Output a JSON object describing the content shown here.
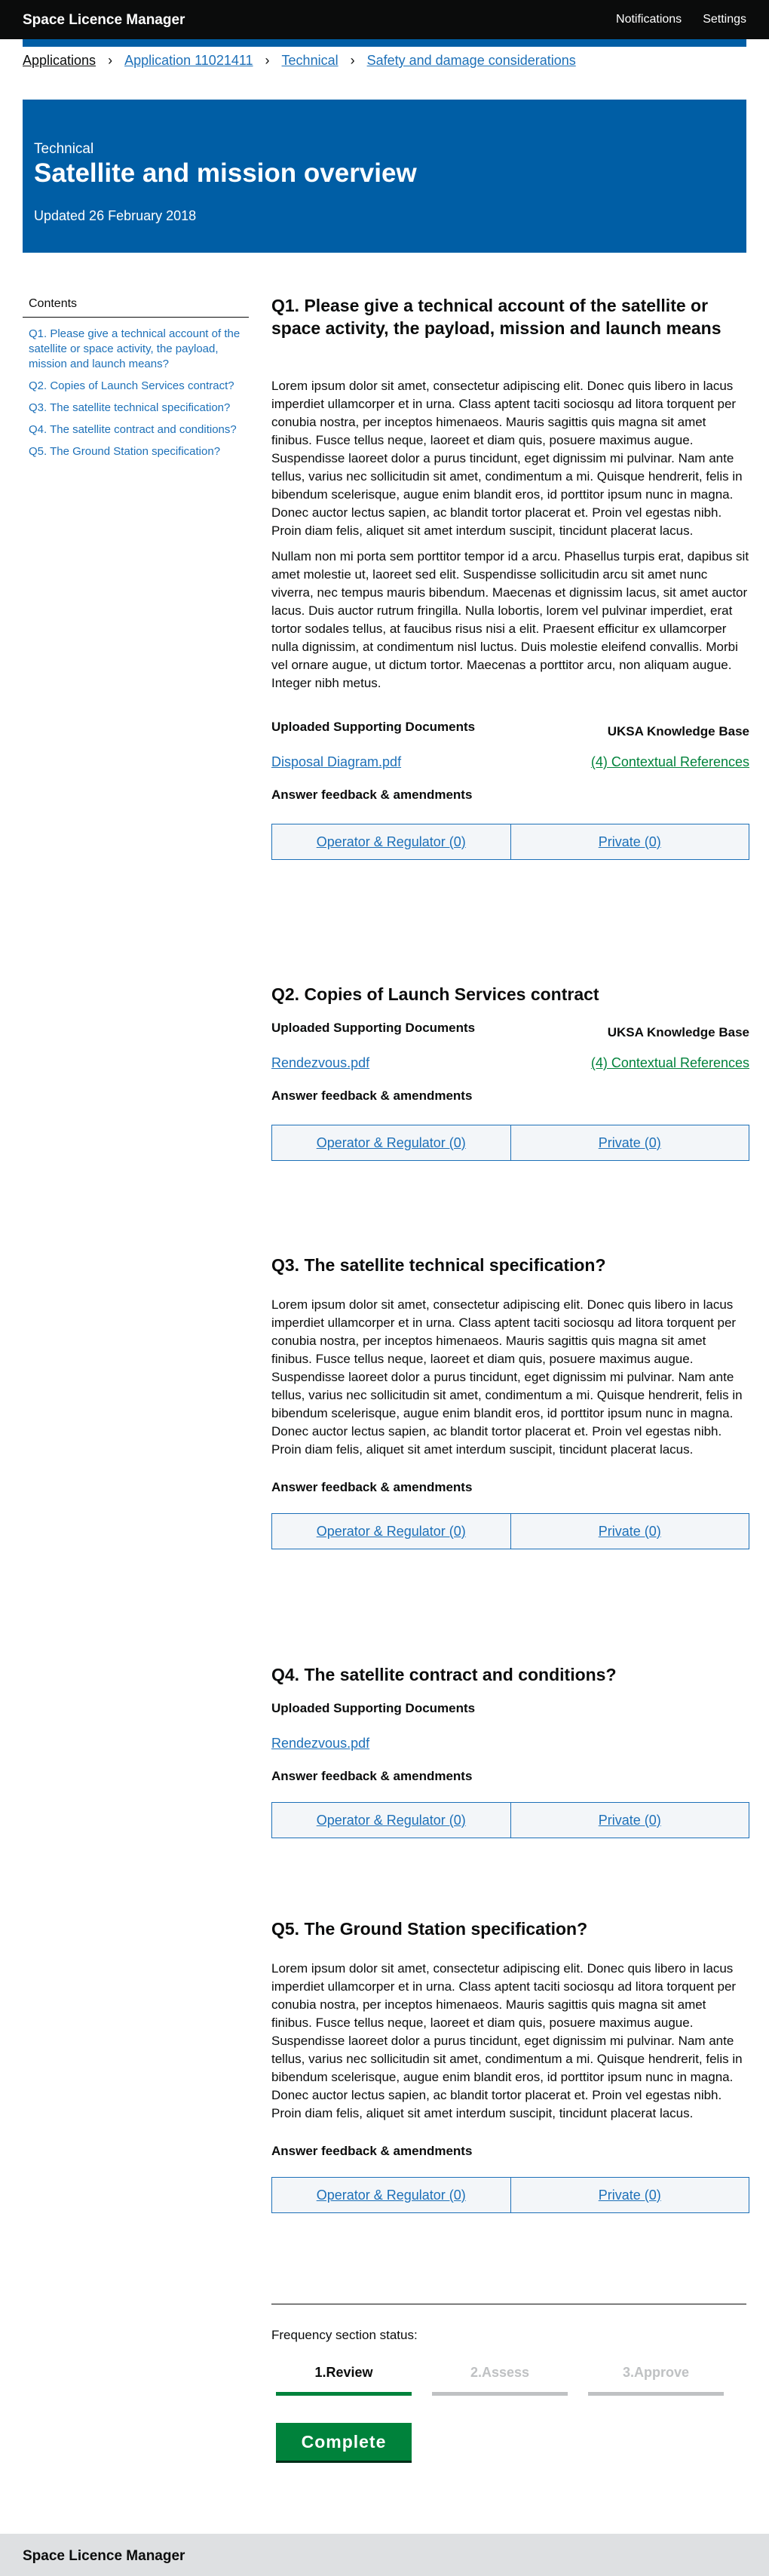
{
  "header": {
    "brand": "Space Licence Manager",
    "nav": [
      "Notifications",
      "Settings"
    ]
  },
  "breadcrumb": [
    "Applications",
    "Application 11021411",
    "Technical",
    "Safety and damage considerations"
  ],
  "hero": {
    "caption": "Technical",
    "title": "Satellite and mission overview",
    "updated": "Updated 26 February 2018"
  },
  "contents": {
    "heading": "Contents",
    "items": [
      "Q1. Please give a technical account of the satellite or space activity, the payload, mission and launch means?",
      "Q2. Copies of Launch Services contract?",
      "Q3. The satellite technical specification?",
      "Q4. The satellite contract and conditions?",
      "Q5. The Ground Station specification?"
    ]
  },
  "labels": {
    "uploaded": "Uploaded Supporting Documents",
    "knowledge_base": "UKSA Knowledge Base",
    "feedback": "Answer feedback & amendments",
    "operator_tab": "Operator & Regulator (0)",
    "private_tab": "Private (0)"
  },
  "questions": [
    {
      "title": "Q1. Please give a technical account of the satellite or space activity, the payload, mission and launch means",
      "paragraphs": [
        "Lorem ipsum dolor sit amet, consectetur adipiscing elit. Donec quis libero in lacus imperdiet ullamcorper et in urna. Class aptent taciti sociosqu ad litora torquent per conubia nostra, per inceptos himenaeos. Mauris sagittis quis magna sit amet finibus. Fusce tellus neque, laoreet et diam quis, posuere maximus augue. Suspendisse laoreet dolor a purus tincidunt, eget dignissim mi pulvinar. Nam ante tellus, varius nec sollicitudin sit amet, condimentum a mi. Quisque hendrerit, felis in bibendum scelerisque, augue enim blandit eros, id porttitor ipsum nunc in magna. Donec auctor lectus sapien, ac blandit tortor placerat et. Proin vel egestas nibh. Proin diam felis, aliquet sit amet interdum suscipit, tincidunt placerat lacus.",
        "Nullam non mi porta sem porttitor tempor id a arcu. Phasellus turpis erat, dapibus sit amet molestie ut, laoreet sed elit. Suspendisse sollicitudin arcu sit amet nunc viverra, nec tempus mauris bibendum. Maecenas et dignissim lacus, sit amet auctor lacus. Duis auctor rutrum fringilla. Nulla lobortis, lorem vel pulvinar imperdiet, erat tortor sodales tellus, at faucibus risus nisi a elit. Praesent efficitur ex ullamcorper nulla dignissim, at condimentum nisl luctus. Duis molestie eleifend convallis. Morbi vel ornare augue, ut dictum tortor. Maecenas a porttitor arcu, non aliquam augue. Integer nibh metus."
      ],
      "file": "Disposal Diagram.pdf",
      "refs": "(4) Contextual References"
    },
    {
      "title": "Q2. Copies of Launch Services contract",
      "file": "Rendezvous.pdf",
      "refs": "(4) Contextual References"
    },
    {
      "title": "Q3. The satellite technical specification?",
      "paragraphs": [
        "Lorem ipsum dolor sit amet, consectetur adipiscing elit. Donec quis libero in lacus imperdiet ullamcorper et in urna. Class aptent taciti sociosqu ad litora torquent per conubia nostra, per inceptos himenaeos. Mauris sagittis quis magna sit amet finibus. Fusce tellus neque, laoreet et diam quis, posuere maximus augue. Suspendisse laoreet dolor a purus tincidunt, eget dignissim mi pulvinar. Nam ante tellus, varius nec sollicitudin sit amet, condimentum a mi. Quisque hendrerit, felis in bibendum scelerisque, augue enim blandit eros, id porttitor ipsum nunc in magna. Donec auctor lectus sapien, ac blandit tortor placerat et. Proin vel egestas nibh. Proin diam felis, aliquet sit amet interdum suscipit, tincidunt placerat lacus."
      ]
    },
    {
      "title": "Q4. The satellite contract and conditions?",
      "file": "Rendezvous.pdf"
    },
    {
      "title": "Q5. The Ground Station specification?",
      "paragraphs": [
        "Lorem ipsum dolor sit amet, consectetur adipiscing elit. Donec quis libero in lacus imperdiet ullamcorper et in urna. Class aptent taciti sociosqu ad litora torquent per conubia nostra, per inceptos himenaeos. Mauris sagittis quis magna sit amet finibus. Fusce tellus neque, laoreet et diam quis, posuere maximus augue. Suspendisse laoreet dolor a purus tincidunt, eget dignissim mi pulvinar. Nam ante tellus, varius nec sollicitudin sit amet, condimentum a mi. Quisque hendrerit, felis in bibendum scelerisque, augue enim blandit eros, id porttitor ipsum nunc in magna. Donec auctor lectus sapien, ac blandit tortor placerat et. Proin vel egestas nibh. Proin diam felis, aliquet sit amet interdum suscipit, tincidunt placerat lacus."
      ]
    }
  ],
  "status": {
    "label": "Frequency section status:",
    "steps": [
      "1.Review",
      "2.Assess",
      "3.Approve"
    ],
    "active_step": "1.Review",
    "button": "Complete"
  },
  "footer": {
    "brand": "Space Licence Manager"
  },
  "colors": {
    "header_bg": "#0b0c0c",
    "brand_blue": "#005ea5",
    "link": "#1d70b8",
    "green": "#00823b",
    "grey": "#bfc1c3",
    "footer_bg": "#dee0e2"
  }
}
